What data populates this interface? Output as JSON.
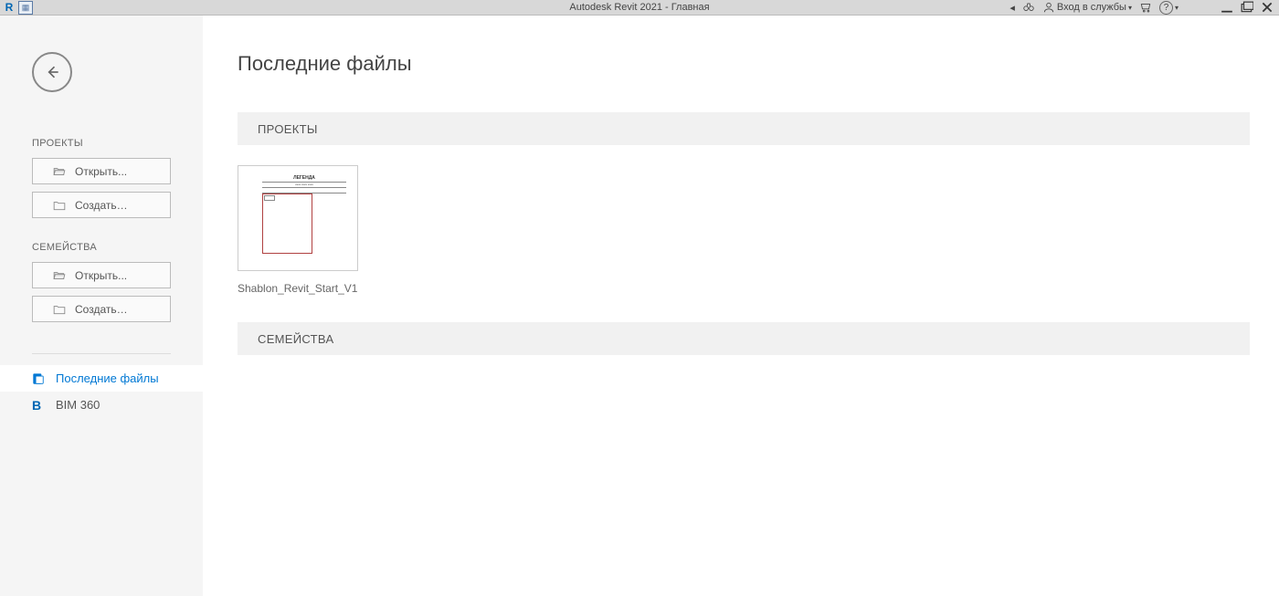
{
  "titlebar": {
    "title": "Autodesk Revit 2021 - Главная",
    "login": "Вход в службы"
  },
  "sidebar": {
    "projects_heading": "ПРОЕКТЫ",
    "projects_open": "Открыть...",
    "projects_create": "Создать…",
    "families_heading": "СЕМЕЙСТВА",
    "families_open": "Открыть...",
    "families_create": "Создать…",
    "nav_recent": "Последние файлы",
    "nav_bim360": "BIM 360"
  },
  "content": {
    "page_title": "Последние файлы",
    "section_projects": "ПРОЕКТЫ",
    "section_families": "СЕМЕЙСТВА",
    "recent_files": [
      {
        "name": "Shablon_Revit_Start_V1",
        "thumb_label": "ЛЕГЕНДА"
      }
    ]
  }
}
